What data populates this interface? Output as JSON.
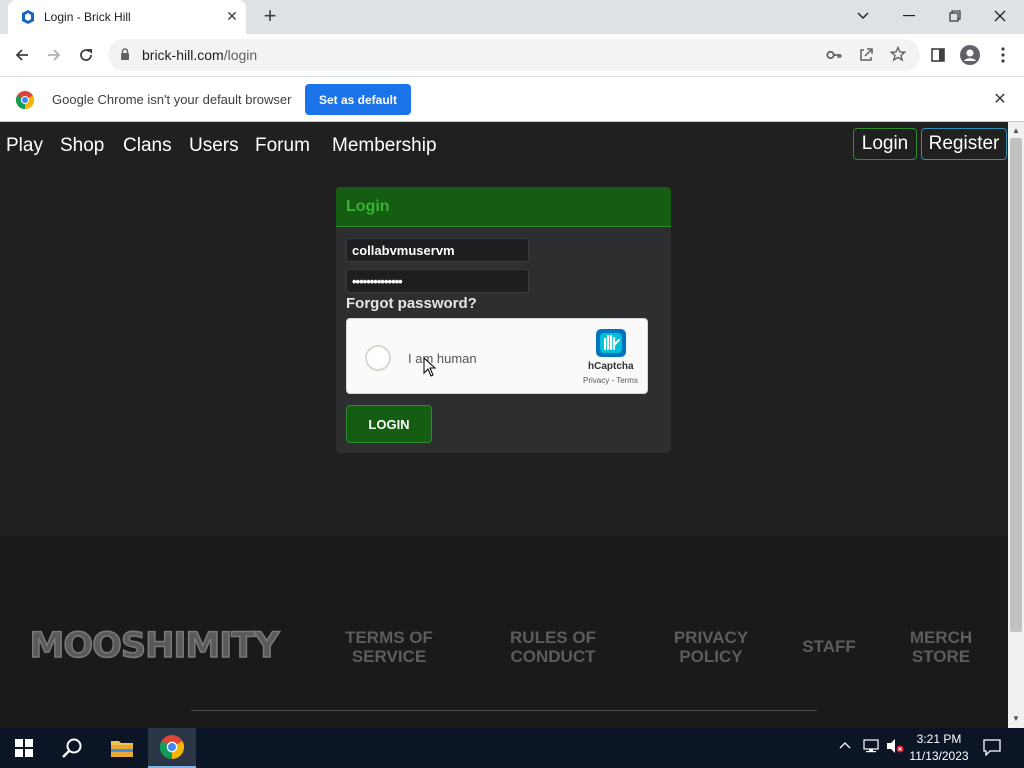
{
  "browser": {
    "tab_title": "Login - Brick Hill",
    "url_host": "brick-hill.com",
    "url_path": "/login",
    "infobar_text": "Google Chrome isn't your default browser",
    "infobar_button": "Set as default"
  },
  "nav": {
    "items": [
      "Play",
      "Shop",
      "Clans",
      "Users",
      "Forum",
      "Membership"
    ],
    "login": "Login",
    "register": "Register"
  },
  "login_card": {
    "title": "Login",
    "username_value": "collabvmuservm",
    "password_value": "••••••••••••••",
    "forgot": "Forgot password?",
    "captcha_label": "I am human",
    "captcha_brand": "hCaptcha",
    "captcha_links": "Privacy - Terms",
    "submit": "LOGIN"
  },
  "footer": {
    "logo_text": "MOOSHIMITY",
    "links": [
      {
        "line1": "TERMS OF",
        "line2": "SERVICE"
      },
      {
        "line1": "RULES OF",
        "line2": "CONDUCT"
      },
      {
        "line1": "PRIVACY",
        "line2": "POLICY"
      },
      {
        "line1": "STAFF",
        "line2": ""
      },
      {
        "line1": "MERCH",
        "line2": "STORE"
      }
    ]
  },
  "taskbar": {
    "time": "3:21 PM",
    "date": "11/13/2023"
  },
  "colors": {
    "accent_green": "#155d12",
    "title_green": "#39b133",
    "chrome_blue": "#1a73e8"
  }
}
